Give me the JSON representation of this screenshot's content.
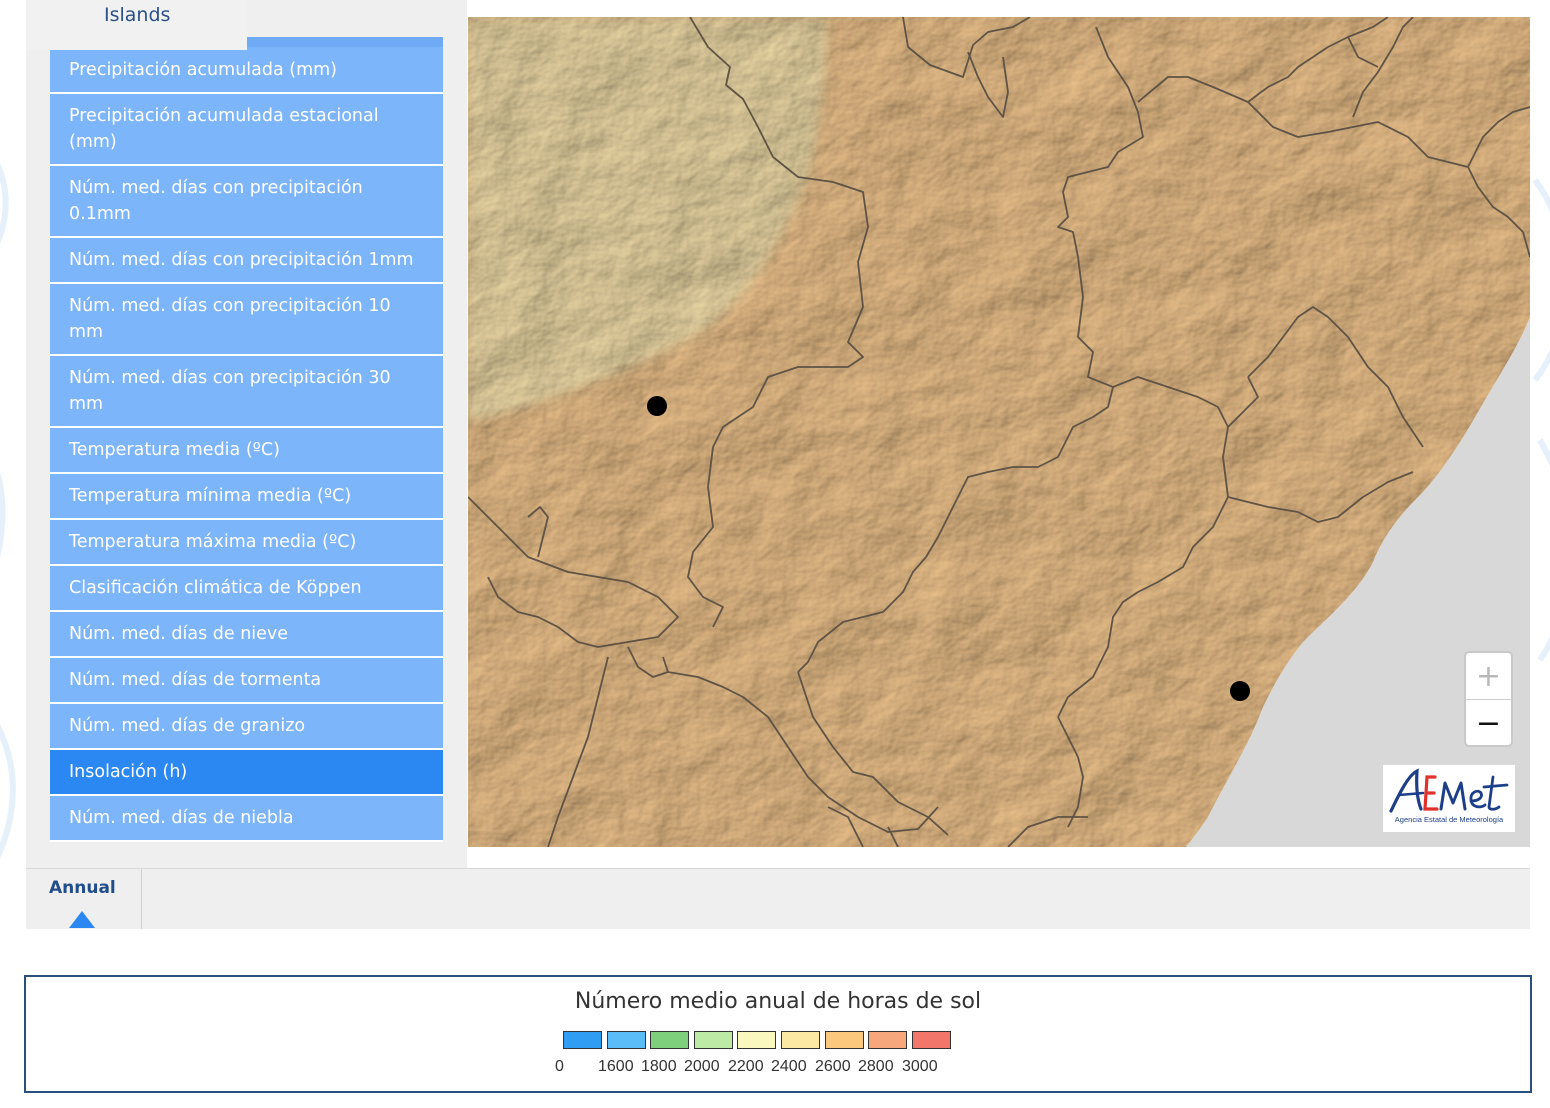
{
  "region_tab": {
    "label": "Islands"
  },
  "menu": {
    "items": [
      {
        "label": "Precipitación acumulada (mm)",
        "active": false
      },
      {
        "label": "Precipitación acumulada estacional (mm)",
        "active": false
      },
      {
        "label": "Núm. med. días con precipitación 0.1mm",
        "active": false
      },
      {
        "label": "Núm. med. días con precipitación 1mm",
        "active": false
      },
      {
        "label": "Núm. med. días con precipitación 10 mm",
        "active": false
      },
      {
        "label": "Núm. med. días con precipitación 30 mm",
        "active": false
      },
      {
        "label": "Temperatura media (ºC)",
        "active": false
      },
      {
        "label": "Temperatura mínima media (ºC)",
        "active": false
      },
      {
        "label": "Temperatura máxima media (ºC)",
        "active": false
      },
      {
        "label": "Clasificación climática de Köppen",
        "active": false
      },
      {
        "label": "Núm. med. días de nieve",
        "active": false
      },
      {
        "label": "Núm. med. días de tormenta",
        "active": false
      },
      {
        "label": "Núm. med. días de granizo",
        "active": false
      },
      {
        "label": "Insolación (h)",
        "active": true
      },
      {
        "label": "Núm. med. días de niebla",
        "active": false
      }
    ]
  },
  "map": {
    "zoom_in_label": "+",
    "zoom_out_label": "−",
    "logo_text": "AEMet",
    "logo_subtext": "Agencia Estatal de Meteorología",
    "colors": {
      "sea": "#d8d8d8",
      "land_main": "#f0c58e",
      "land_light": "#f2deaa"
    }
  },
  "period_tabs": {
    "items": [
      {
        "label": "Annual",
        "active": true
      }
    ]
  },
  "legend": {
    "title": "Número medio anual de horas de sol",
    "labels": [
      "0",
      "1600",
      "1800",
      "2000",
      "2200",
      "2400",
      "2600",
      "2800",
      "3000"
    ],
    "colors": [
      "#2f9df2",
      "#5bbdf7",
      "#7ed07c",
      "#bdeba5",
      "#fbf8bf",
      "#fce7a3",
      "#fbc87e",
      "#f6a77b",
      "#f2766a"
    ]
  },
  "colors": {
    "menu_item": "#7db5fb",
    "menu_active": "#2b87f1",
    "tab_text": "#214e8a"
  }
}
